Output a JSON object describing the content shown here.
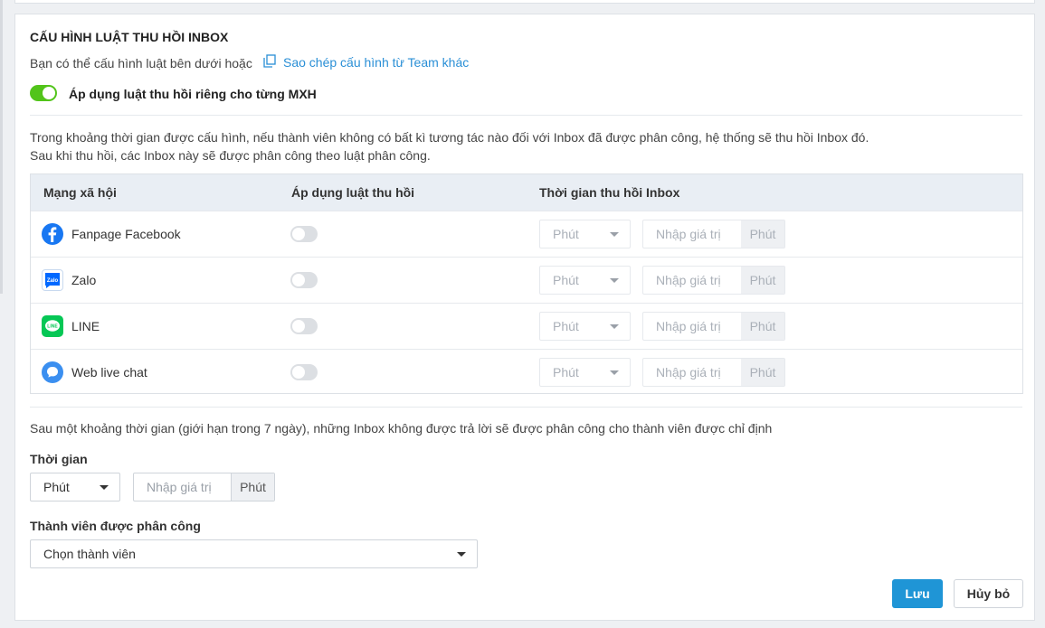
{
  "section": {
    "title": "CẤU HÌNH LUẬT THU HỒI INBOX",
    "description": "Bạn có thể cấu hình luật bên dưới hoặc",
    "copy_link": "Sao chép cấu hình từ Team khác",
    "toggle_label": "Áp dụng luật thu hồi riêng cho từng MXH",
    "toggle_on": true,
    "accent_color": "#52c41a",
    "link_color": "#2a8fd6"
  },
  "explain": {
    "line1": "Trong khoảng thời gian được cấu hình, nếu thành viên không có bất kì tương tác nào đối với Inbox đã được phân công, hệ thống sẽ thu hồi Inbox đó.",
    "line2": "Sau khi thu hồi, các Inbox này sẽ được phân công theo luật phân công."
  },
  "table": {
    "headers": [
      "Mạng xã hội",
      "Áp dụng luật thu hồi",
      "Thời gian thu hồi Inbox"
    ],
    "rows": [
      {
        "name": "Fanpage Facebook",
        "icon": "facebook-icon",
        "enabled": false,
        "unit_select": "Phút",
        "placeholder": "Nhập giá trị",
        "unit": "Phút"
      },
      {
        "name": "Zalo",
        "icon": "zalo-icon",
        "enabled": false,
        "unit_select": "Phút",
        "placeholder": "Nhập giá trị",
        "unit": "Phút"
      },
      {
        "name": "LINE",
        "icon": "line-icon",
        "enabled": false,
        "unit_select": "Phút",
        "placeholder": "Nhập giá trị",
        "unit": "Phút"
      },
      {
        "name": "Web live chat",
        "icon": "chat-icon",
        "enabled": false,
        "unit_select": "Phút",
        "placeholder": "Nhập giá trị",
        "unit": "Phút"
      }
    ]
  },
  "fallback": {
    "description": "Sau một khoảng thời gian (giới hạn trong 7 ngày), những Inbox không được trả lời sẽ được phân công cho thành viên được chỉ định",
    "time_label": "Thời gian",
    "time_unit_select": "Phút",
    "time_placeholder": "Nhập giá trị",
    "time_unit": "Phút",
    "member_label": "Thành viên được phân công",
    "member_select": "Chọn thành viên"
  },
  "actions": {
    "save": "Lưu",
    "cancel": "Hủy bỏ",
    "save_color": "#1f95d6"
  }
}
